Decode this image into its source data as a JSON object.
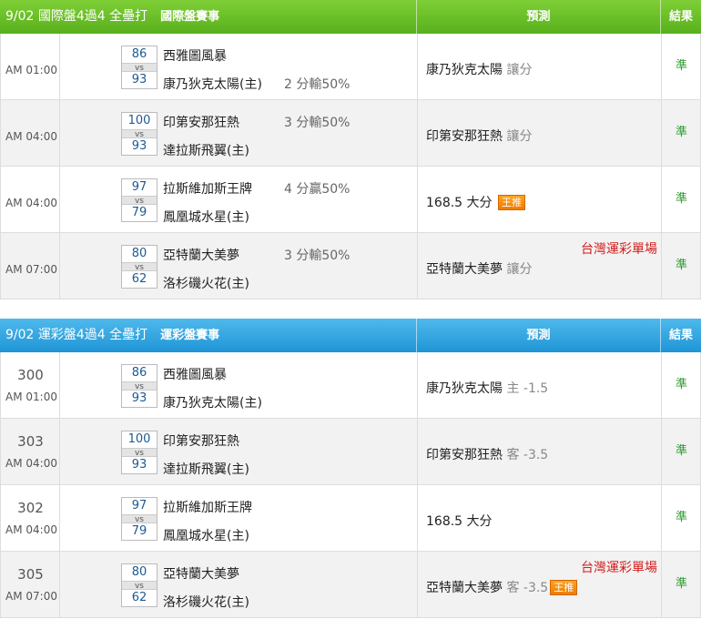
{
  "headers": {
    "prediction": "預測",
    "result": "結果"
  },
  "intl": {
    "title": "9/02 國際盤4過4 全壘打",
    "subtitle": "國際盤賽事",
    "rows": [
      {
        "time": "AM 01:00",
        "num": "",
        "score_a": "86",
        "score_b": "93",
        "vs": "vs",
        "team_a": "西雅圖風暴",
        "team_b": "康乃狄克太陽(主)",
        "odds_a": "",
        "odds_b": "2 分輸50%",
        "pred_team": "康乃狄克太陽",
        "pred_mark": "讓分",
        "badge": "",
        "note": "",
        "result": "準"
      },
      {
        "time": "AM 04:00",
        "num": "",
        "score_a": "100",
        "score_b": "93",
        "vs": "vs",
        "team_a": "印第安那狂熱",
        "team_b": "達拉斯飛翼(主)",
        "odds_a": "3 分輸50%",
        "odds_b": "",
        "pred_team": "印第安那狂熱",
        "pred_mark": "讓分",
        "badge": "",
        "note": "",
        "result": "準"
      },
      {
        "time": "AM 04:00",
        "num": "",
        "score_a": "97",
        "score_b": "79",
        "vs": "vs",
        "team_a": "拉斯維加斯王牌",
        "team_b": "鳳凰城水星(主)",
        "odds_a": "4 分贏50%",
        "odds_b": "",
        "pred_team": "168.5 大分",
        "pred_mark": "",
        "badge": "王推",
        "note": "",
        "result": "準"
      },
      {
        "time": "AM 07:00",
        "num": "",
        "score_a": "80",
        "score_b": "62",
        "vs": "vs",
        "team_a": "亞特蘭大美夢",
        "team_b": "洛杉磯火花(主)",
        "odds_a": "3 分輸50%",
        "odds_b": "",
        "pred_team": "亞特蘭大美夢",
        "pred_mark": "讓分",
        "badge": "",
        "note": "台灣運彩單場",
        "result": "準"
      }
    ]
  },
  "tw": {
    "title": "9/02 運彩盤4過4 全壘打",
    "subtitle": "運彩盤賽事",
    "rows": [
      {
        "time": "AM 01:00",
        "num": "300",
        "score_a": "86",
        "score_b": "93",
        "vs": "vs",
        "team_a": "西雅圖風暴",
        "team_b": "康乃狄克太陽(主)",
        "odds_a": "",
        "odds_b": "",
        "pred_team": "康乃狄克太陽",
        "pred_mark": "主 -1.5",
        "badge": "",
        "note": "",
        "result": "準"
      },
      {
        "time": "AM 04:00",
        "num": "303",
        "score_a": "100",
        "score_b": "93",
        "vs": "vs",
        "team_a": "印第安那狂熱",
        "team_b": "達拉斯飛翼(主)",
        "odds_a": "",
        "odds_b": "",
        "pred_team": "印第安那狂熱",
        "pred_mark": "客 -3.5",
        "badge": "",
        "note": "",
        "result": "準"
      },
      {
        "time": "AM 04:00",
        "num": "302",
        "score_a": "97",
        "score_b": "79",
        "vs": "vs",
        "team_a": "拉斯維加斯王牌",
        "team_b": "鳳凰城水星(主)",
        "odds_a": "",
        "odds_b": "",
        "pred_team": "168.5 大分",
        "pred_mark": "",
        "badge": "",
        "note": "",
        "result": "準"
      },
      {
        "time": "AM 07:00",
        "num": "305",
        "score_a": "80",
        "score_b": "62",
        "vs": "vs",
        "team_a": "亞特蘭大美夢",
        "team_b": "洛杉磯火花(主)",
        "odds_a": "",
        "odds_b": "",
        "pred_team": "亞特蘭大美夢",
        "pred_mark": "客 -3.5",
        "badge": "王推",
        "note": "台灣運彩單場",
        "result": "準"
      }
    ]
  },
  "colors": {
    "intl_header": "#66bb22",
    "tw_header": "#2aa3df",
    "note": "#d21c1c",
    "result": "#2a9a2a",
    "badge": "#f58a0b"
  }
}
